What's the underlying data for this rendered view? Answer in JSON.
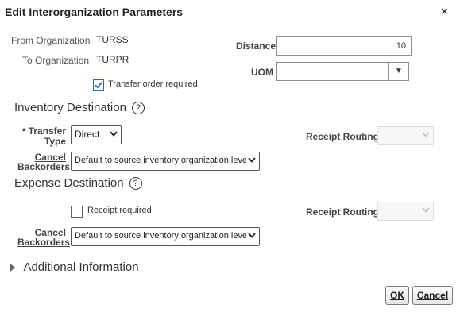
{
  "dialog": {
    "title": "Edit Interorganization Parameters",
    "close": "×"
  },
  "header": {
    "from_label": "From Organization",
    "from_value": "TURSS",
    "to_label": "To Organization",
    "to_value": "TURPR",
    "transfer_order_label": "Transfer order required",
    "transfer_order_checked": true,
    "distance_label": "Distance",
    "distance_value": "10",
    "uom_label": "UOM",
    "uom_value": ""
  },
  "inventory": {
    "heading": "Inventory Destination",
    "help_icon": "question-circle-icon",
    "required_marker": "*",
    "transfer_type_label_1": "Transfer",
    "transfer_type_label_2": "Type",
    "transfer_type_value": "Direct",
    "receipt_routing_label": "Receipt Routing",
    "receipt_routing_value": "",
    "cancel_label_1": "Cancel",
    "cancel_label_2": "Backorders",
    "cancel_value": "Default to source inventory organization level"
  },
  "expense": {
    "heading": "Expense Destination",
    "help_icon": "question-circle-icon",
    "receipt_required_label": "Receipt required",
    "receipt_required_checked": false,
    "receipt_routing_label": "Receipt Routing",
    "receipt_routing_value": "",
    "cancel_label_1": "Cancel",
    "cancel_label_2": "Backorders",
    "cancel_value": "Default to source inventory organization level"
  },
  "additional": {
    "label": "Additional Information"
  },
  "buttons": {
    "ok": "OK",
    "cancel": "Cancel"
  }
}
